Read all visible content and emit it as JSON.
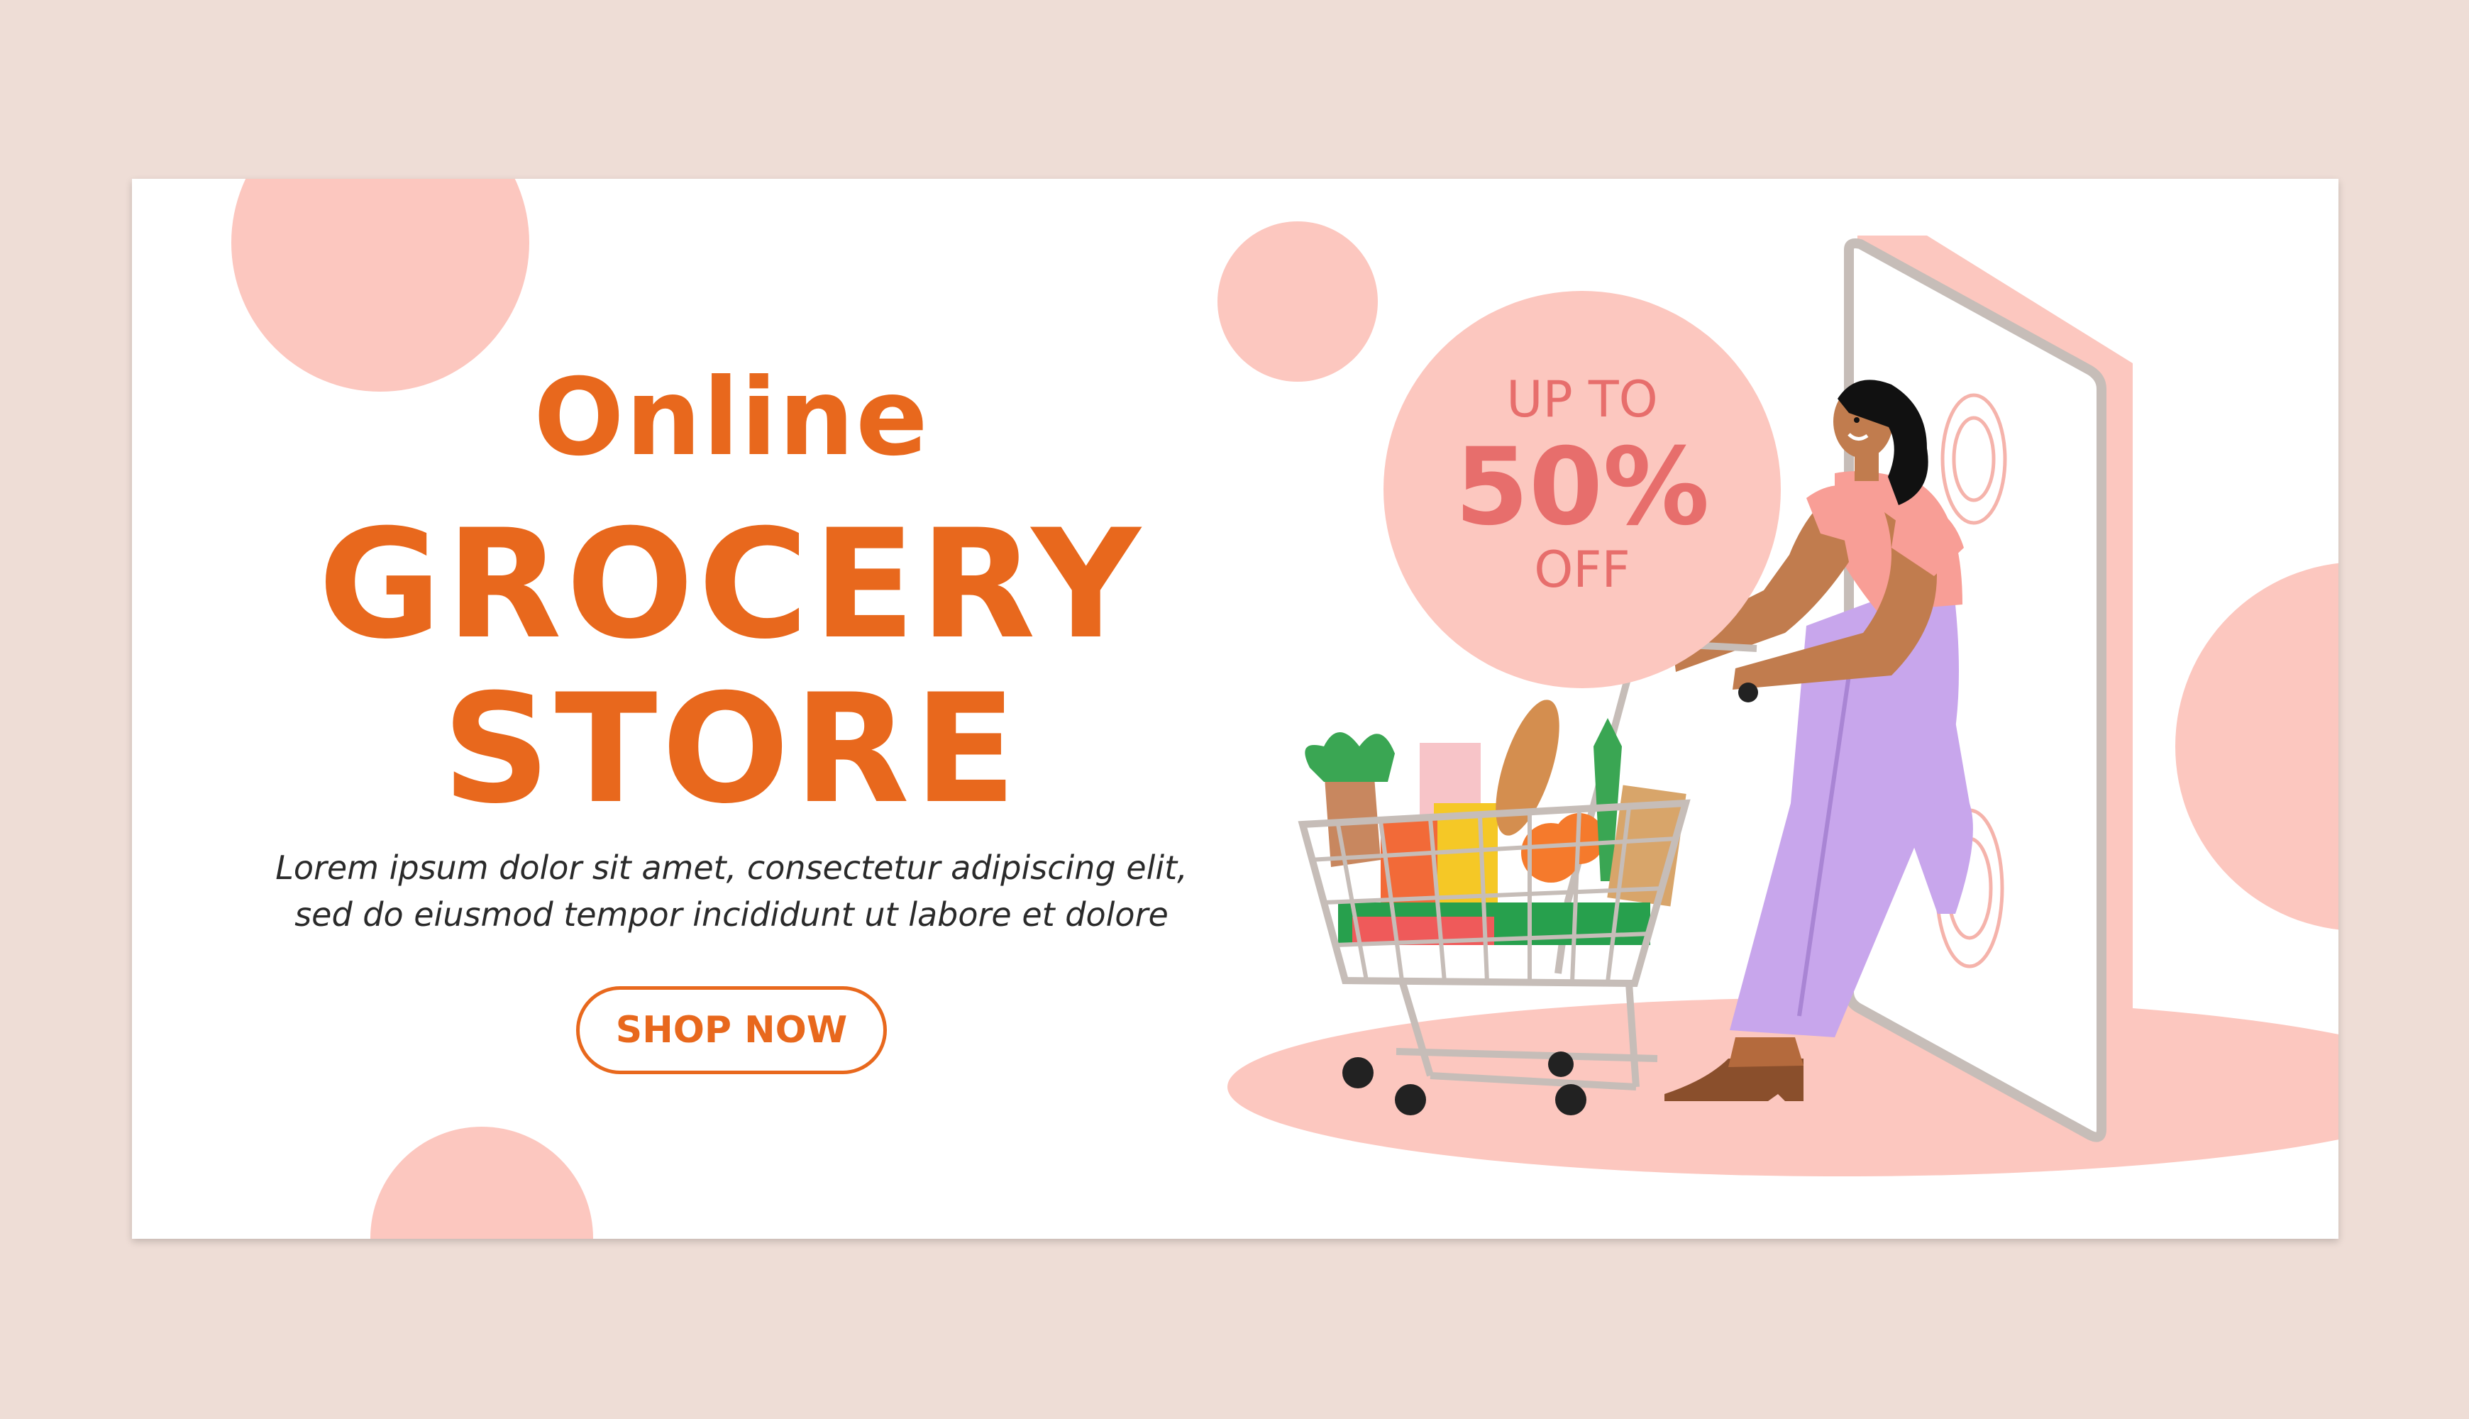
{
  "banner": {
    "title_line1": "Online",
    "title_line2": "GROCERY",
    "title_line3": "STORE",
    "description_line1": "Lorem ipsum dolor sit amet, consectetur adipiscing elit,",
    "description_line2": "sed do eiusmod tempor incididunt ut labore et dolore",
    "cta_label": "SHOP NOW"
  },
  "offer": {
    "line1": "UP TO",
    "line2": "50%",
    "line3": "OFF"
  },
  "colors": {
    "page_background": "#eeddd6",
    "accent_orange": "#e8681d",
    "circle_pink": "#fcc7bf",
    "offer_text": "#e76e6c"
  },
  "icons": [
    "shopping-cart-icon",
    "smartphone-icon",
    "shopper-woman-illustration"
  ]
}
